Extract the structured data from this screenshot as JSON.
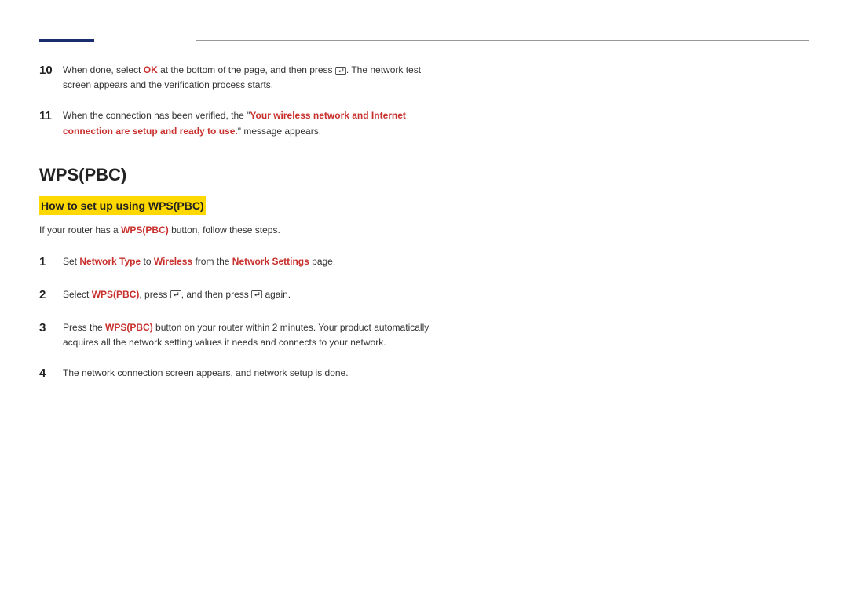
{
  "steps_top": [
    {
      "num": "10",
      "parts": [
        {
          "t": "text",
          "v": "When done, select "
        },
        {
          "t": "red",
          "v": "OK"
        },
        {
          "t": "text",
          "v": " at the bottom of the page, and then press "
        },
        {
          "t": "icon"
        },
        {
          "t": "text",
          "v": ". The network test screen appears and the verification process starts."
        }
      ]
    },
    {
      "num": "11",
      "parts": [
        {
          "t": "text",
          "v": "When the connection has been verified, the \""
        },
        {
          "t": "red",
          "v": "Your wireless network and Internet connection are setup and ready to use."
        },
        {
          "t": "text",
          "v": "\" message appears."
        }
      ]
    }
  ],
  "section_title": "WPS(PBC)",
  "subsection": "How to set up using WPS(PBC)",
  "intro": {
    "parts": [
      {
        "t": "text",
        "v": "If your router has a "
      },
      {
        "t": "red",
        "v": "WPS(PBC)"
      },
      {
        "t": "text",
        "v": " button, follow these steps."
      }
    ]
  },
  "steps_wps": [
    {
      "num": "1",
      "parts": [
        {
          "t": "text",
          "v": "Set "
        },
        {
          "t": "red",
          "v": "Network Type"
        },
        {
          "t": "text",
          "v": " to "
        },
        {
          "t": "red",
          "v": "Wireless"
        },
        {
          "t": "text",
          "v": " from the "
        },
        {
          "t": "red",
          "v": "Network Settings"
        },
        {
          "t": "text",
          "v": " page."
        }
      ]
    },
    {
      "num": "2",
      "parts": [
        {
          "t": "text",
          "v": "Select "
        },
        {
          "t": "red",
          "v": "WPS(PBC)"
        },
        {
          "t": "text",
          "v": ", press "
        },
        {
          "t": "icon"
        },
        {
          "t": "text",
          "v": ", and then press "
        },
        {
          "t": "icon"
        },
        {
          "t": "text",
          "v": " again."
        }
      ]
    },
    {
      "num": "3",
      "parts": [
        {
          "t": "text",
          "v": "Press the "
        },
        {
          "t": "red",
          "v": "WPS(PBC)"
        },
        {
          "t": "text",
          "v": " button on your router within 2 minutes. Your product automatically acquires all the network setting values it needs and connects to your network."
        }
      ]
    },
    {
      "num": "4",
      "parts": [
        {
          "t": "text",
          "v": "The network connection screen appears, and network setup is done."
        }
      ]
    }
  ]
}
